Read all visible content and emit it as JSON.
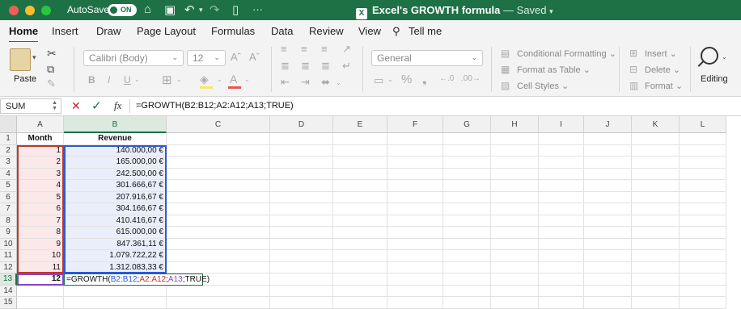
{
  "titlebar": {
    "autosave_label": "AutoSave",
    "autosave_state": "ON",
    "doc_title": "Excel's GROWTH formula",
    "saved_status": "— Saved",
    "more": "···"
  },
  "tabs": [
    "Home",
    "Insert",
    "Draw",
    "Page Layout",
    "Formulas",
    "Data",
    "Review",
    "View",
    "Tell me"
  ],
  "ribbon": {
    "paste_label": "Paste",
    "font_name": "Calibri (Body)",
    "font_size": "12",
    "number_format": "General",
    "conditional_formatting": "Conditional Formatting",
    "format_as_table": "Format as Table",
    "cell_styles": "Cell Styles",
    "insert": "Insert",
    "delete": "Delete",
    "format": "Format",
    "editing": "Editing"
  },
  "formula_bar": {
    "name_box": "SUM",
    "formula": "=GROWTH(B2:B12;A2:A12;A13;TRUE)"
  },
  "columns": [
    "A",
    "B",
    "C",
    "D",
    "E",
    "F",
    "G",
    "H",
    "I",
    "J",
    "K",
    "L"
  ],
  "rows": [
    "1",
    "2",
    "3",
    "4",
    "5",
    "6",
    "7",
    "8",
    "9",
    "10",
    "11",
    "12",
    "13",
    "14",
    "15"
  ],
  "sheet": {
    "header_month": "Month",
    "header_revenue": "Revenue",
    "months": [
      "1",
      "2",
      "3",
      "4",
      "5",
      "6",
      "7",
      "8",
      "9",
      "10",
      "11"
    ],
    "revenue": [
      "140.000,00 €",
      "165.000,00 €",
      "242.500,00 €",
      "301.666,67 €",
      "207.916,67 €",
      "304.166,67 €",
      "410.416,67 €",
      "615.000,00 €",
      "847.361,11 €",
      "1.079.722,22 €",
      "1.312.083,33 €"
    ],
    "a13": "12",
    "edit_parts": {
      "p0": "=GROWTH(",
      "p1": "B2:B12",
      "p2": ";",
      "p3": "A2:A12",
      "p4": ";",
      "p5": "A13",
      "p6": ";TRUE)"
    }
  },
  "colors": {
    "accent": "#1e7145",
    "ref_b": "#2a5bd7",
    "ref_a": "#c0362c",
    "ref_a13": "#8a45c6"
  }
}
